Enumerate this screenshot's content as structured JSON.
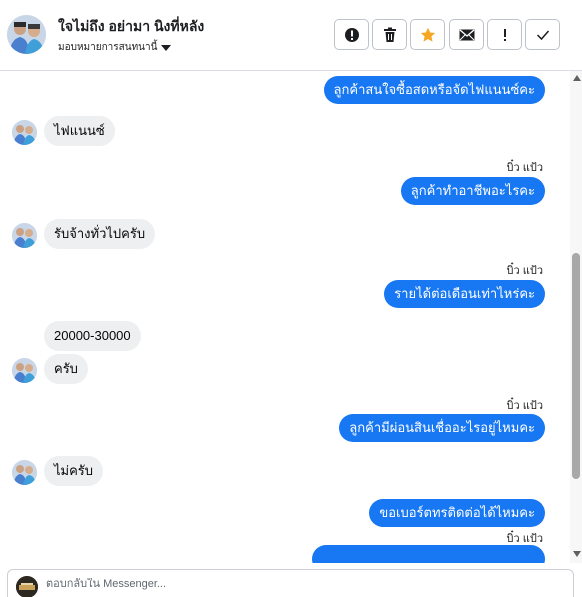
{
  "header": {
    "name": "ใจไม่ถึง อย่ามา นิงที่หลัง",
    "subtitle": "มอบหมายการสนทนานี้"
  },
  "toolbar": {
    "items": [
      {
        "name": "spam-icon",
        "label": "!"
      },
      {
        "name": "trash-icon",
        "label": "trash"
      },
      {
        "name": "star-icon",
        "label": "star"
      },
      {
        "name": "envelope-icon",
        "label": "mail"
      },
      {
        "name": "exclamation-icon",
        "label": "!"
      },
      {
        "name": "checkmark-icon",
        "label": "check"
      }
    ]
  },
  "colors": {
    "outgoing_bubble": "#1877f2",
    "incoming_bubble": "#eeeff1",
    "star": "#f5a623"
  },
  "messages": {
    "m1": "ลูกค้าสนใจซื้อสดหรือจัดไฟแนนซ์คะ",
    "m2": "ไฟแนนซ์",
    "m3_sender": "บิ๋ว แป้ว",
    "m3": "ลูกค้าทำอาชีพอะไรคะ",
    "m4": "รับจ้างทั่วไปครับ",
    "m5_sender": "บิ๋ว แป้ว",
    "m5": "รายได้ต่อเดือนเท่าไหร่คะ",
    "m6": "20000-30000",
    "m7": "ครับ",
    "m8_sender": "บิ๋ว แป้ว",
    "m8": "ลูกค้ามีผ่อนสินเชื่ออะไรอยู่ไหมคะ",
    "m9": "ไม่ครับ",
    "m10": "ขอเบอร์ตทรติดต่อได้ไหมคะ",
    "m11_sender": "บิ๋ว แป้ว"
  },
  "composer": {
    "placeholder": "ตอบกลับใน Messenger..."
  }
}
